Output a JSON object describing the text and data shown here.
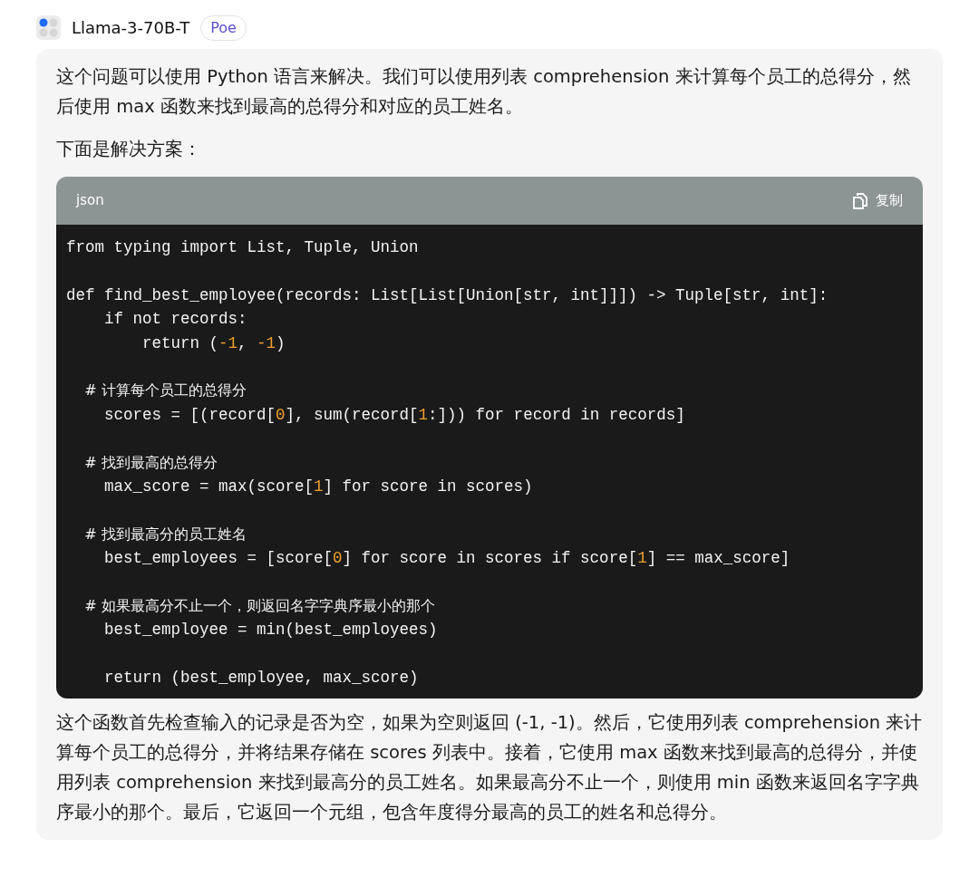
{
  "header": {
    "bot_name": "Llama-3-70B-T",
    "badge": "Poe"
  },
  "message": {
    "intro": "这个问题可以使用 Python 语言来解决。我们可以使用列表 comprehension 来计算每个员工的总得分，然后使用 max 函数来找到最高的总得分和对应的员工姓名。",
    "lead": "下面是解决方案：",
    "code_block": {
      "language": "json",
      "copy_label": "复制",
      "lines": [
        {
          "kind": "code",
          "segments": [
            {
              "kind": "plain",
              "text": "from typing import List, Tuple, Union"
            }
          ]
        },
        {
          "kind": "blank"
        },
        {
          "kind": "code",
          "segments": [
            {
              "kind": "plain",
              "text": "def find_best_employee(records: List[List[Union[str, int]]]) -> Tuple[str, int]:"
            }
          ]
        },
        {
          "kind": "code",
          "segments": [
            {
              "kind": "plain",
              "text": "    if not records:"
            }
          ]
        },
        {
          "kind": "code",
          "segments": [
            {
              "kind": "plain",
              "text": "        return ("
            },
            {
              "kind": "number",
              "text": "-1"
            },
            {
              "kind": "plain",
              "text": ", "
            },
            {
              "kind": "number",
              "text": "-1"
            },
            {
              "kind": "plain",
              "text": ")"
            }
          ]
        },
        {
          "kind": "blank"
        },
        {
          "kind": "code",
          "segments": [
            {
              "kind": "comment",
              "text": "    # 计算每个员工的总得分"
            }
          ]
        },
        {
          "kind": "code",
          "segments": [
            {
              "kind": "plain",
              "text": "    scores = [(record["
            },
            {
              "kind": "number",
              "text": "0"
            },
            {
              "kind": "plain",
              "text": "], sum(record["
            },
            {
              "kind": "number",
              "text": "1"
            },
            {
              "kind": "plain",
              "text": ":])) for record in records]"
            }
          ]
        },
        {
          "kind": "blank"
        },
        {
          "kind": "code",
          "segments": [
            {
              "kind": "comment",
              "text": "    # 找到最高的总得分"
            }
          ]
        },
        {
          "kind": "code",
          "segments": [
            {
              "kind": "plain",
              "text": "    max_score = max(score["
            },
            {
              "kind": "number",
              "text": "1"
            },
            {
              "kind": "plain",
              "text": "] for score in scores)"
            }
          ]
        },
        {
          "kind": "blank"
        },
        {
          "kind": "code",
          "segments": [
            {
              "kind": "comment",
              "text": "    # 找到最高分的员工姓名"
            }
          ]
        },
        {
          "kind": "code",
          "segments": [
            {
              "kind": "plain",
              "text": "    best_employees = [score["
            },
            {
              "kind": "number",
              "text": "0"
            },
            {
              "kind": "plain",
              "text": "] for score in scores if score["
            },
            {
              "kind": "number",
              "text": "1"
            },
            {
              "kind": "plain",
              "text": "] == max_score]"
            }
          ]
        },
        {
          "kind": "blank"
        },
        {
          "kind": "code",
          "segments": [
            {
              "kind": "comment",
              "text": "    # 如果最高分不止一个，则返回名字字典序最小的那个"
            }
          ]
        },
        {
          "kind": "code",
          "segments": [
            {
              "kind": "plain",
              "text": "    best_employee = min(best_employees)"
            }
          ]
        },
        {
          "kind": "blank"
        },
        {
          "kind": "code",
          "segments": [
            {
              "kind": "plain",
              "text": "    return (best_employee, max_score)"
            }
          ]
        }
      ]
    },
    "explanation": "这个函数首先检查输入的记录是否为空，如果为空则返回 (-1, -1)。然后，它使用列表 comprehension 来计算每个员工的总得分，并将结果存储在 scores 列表中。接着，它使用 max 函数来找到最高的总得分，并使用列表 comprehension 来找到最高分的员工姓名。如果最高分不止一个，则使用 min 函数来返回名字字典序最小的那个。最后，它返回一个元组，包含年度得分最高的员工的姓名和总得分。"
  }
}
